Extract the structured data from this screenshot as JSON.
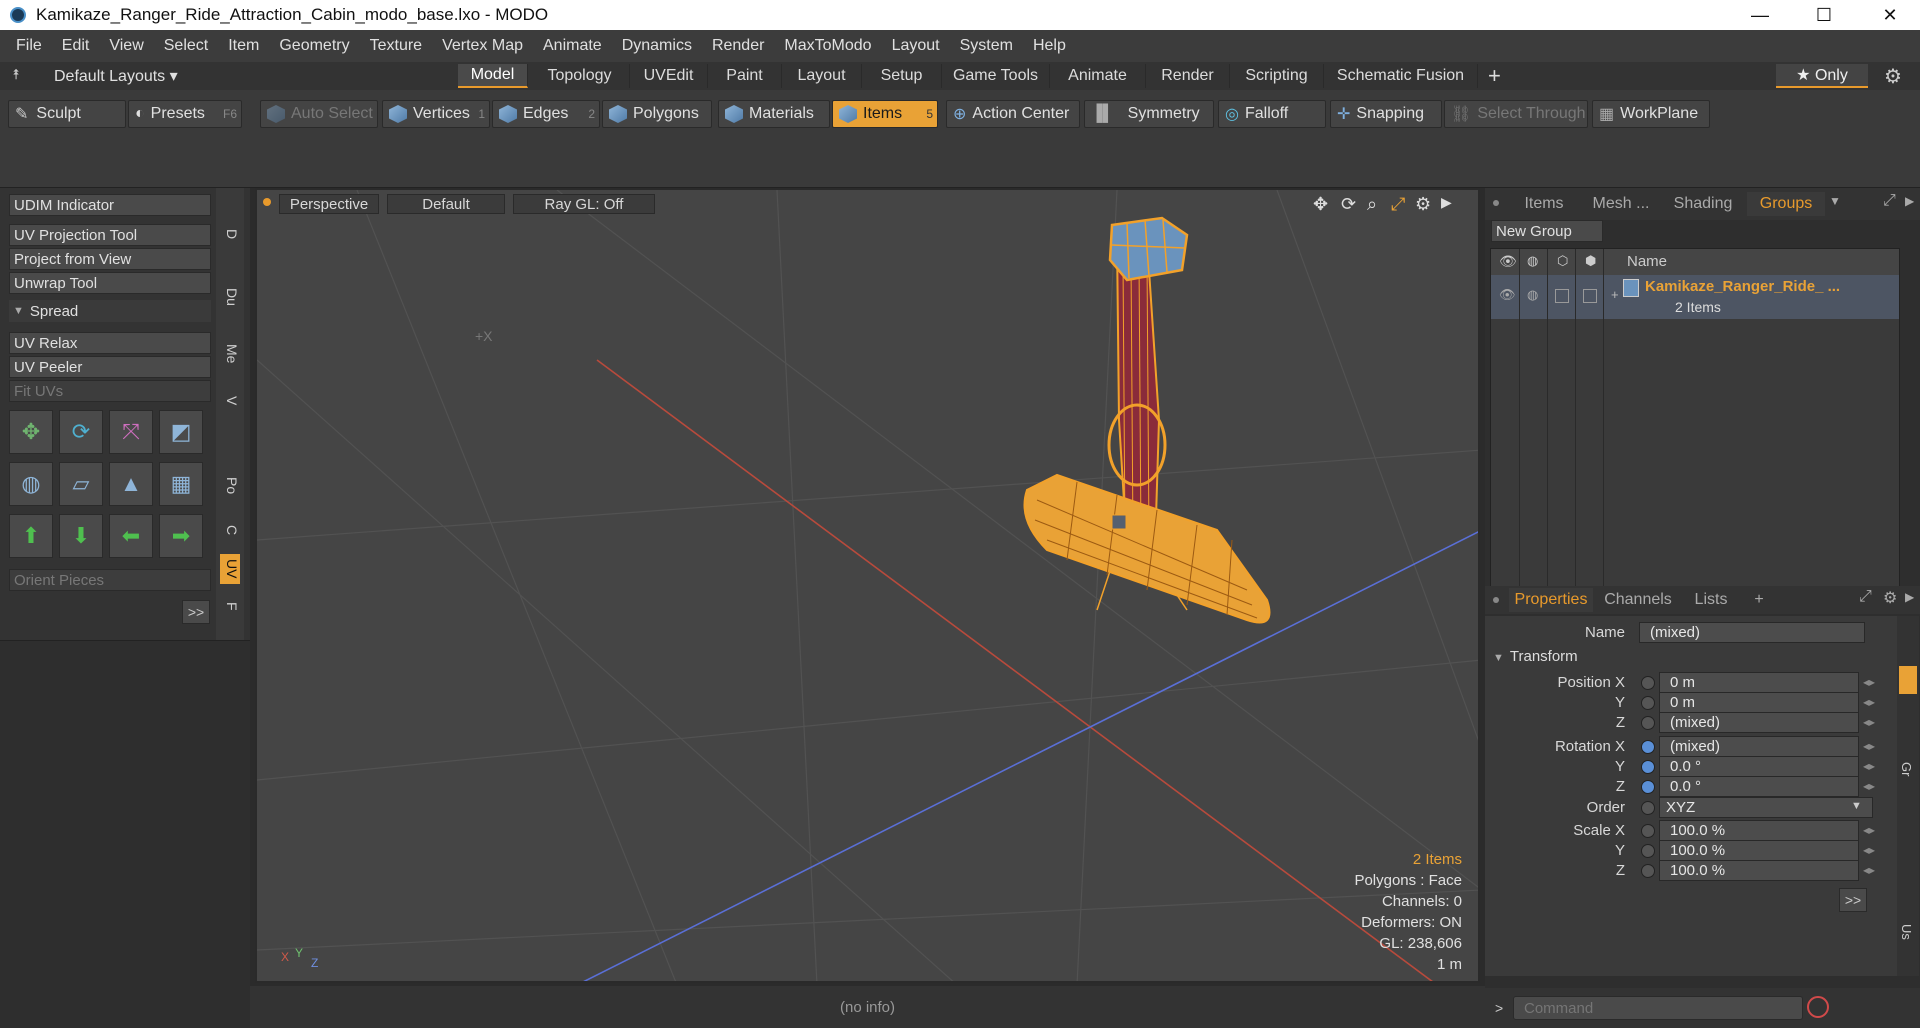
{
  "window": {
    "title": "Kamikaze_Ranger_Ride_Attraction_Cabin_modo_base.lxo - MODO",
    "minimize": "—",
    "maximize": "☐",
    "close": "✕"
  },
  "menu": [
    "File",
    "Edit",
    "View",
    "Select",
    "Item",
    "Geometry",
    "Texture",
    "Vertex Map",
    "Animate",
    "Dynamics",
    "Render",
    "MaxToModo",
    "Layout",
    "System",
    "Help"
  ],
  "layout": {
    "preset": "Default Layouts ▾",
    "tabs": [
      "Model",
      "Topology",
      "UVEdit",
      "Paint",
      "Layout",
      "Setup",
      "Game Tools",
      "Animate",
      "Render",
      "Scripting",
      "Schematic Fusion"
    ],
    "add": "+",
    "only": "★ Only"
  },
  "toolbar": {
    "sculpt": "Sculpt",
    "presets": "Presets",
    "presets_key": "F6",
    "auto_select": "Auto Select",
    "vertices": "Vertices",
    "vertices_num": "1",
    "edges": "Edges",
    "edges_num": "2",
    "polygons": "Polygons",
    "materials": "Materials",
    "items": "Items",
    "items_num": "5",
    "action_center": "Action Center",
    "symmetry": "Symmetry",
    "falloff": "Falloff",
    "snapping": "Snapping",
    "select_through": "Select Through",
    "workplane": "WorkPlane"
  },
  "left": {
    "udim": "UDIM Indicator",
    "uvproj": "UV Projection Tool",
    "projview": "Project from View",
    "unwrap": "Unwrap Tool",
    "spread": "Spread",
    "uvrelax": "UV Relax",
    "uvpeeler": "UV Peeler",
    "fituvs": "Fit UVs",
    "orient": "Orient Pieces",
    "more": ">>",
    "vtabs": [
      "D",
      "Du",
      "Me",
      "V",
      "Po",
      "C",
      "UV",
      "F"
    ]
  },
  "viewport": {
    "view": "Perspective",
    "shading": "Default",
    "raygl": "Ray GL: Off",
    "info": {
      "items": "2 Items",
      "polygons": "Polygons : Face",
      "channels": "Channels: 0",
      "deformers": "Deformers: ON",
      "gl": "GL: 238,606",
      "unit": "1 m"
    },
    "axis_x": "X",
    "axis_y": "Y",
    "axis_z": "Z",
    "marker": "+X"
  },
  "status": "(no info)",
  "groups": {
    "tabs": [
      "Items",
      "Mesh ...",
      "Shading",
      "Groups"
    ],
    "new_group": "New Group",
    "col_name": "Name",
    "row_name": "Kamikaze_Ranger_Ride_ ...",
    "row_count": "2 Items"
  },
  "props": {
    "tabs": [
      "Properties",
      "Channels",
      "Lists"
    ],
    "add": "+",
    "name_label": "Name",
    "name_value": "(mixed)",
    "transform": "Transform",
    "rows": [
      {
        "label": "Position X",
        "value": "0 m"
      },
      {
        "label": "Y",
        "value": "0 m"
      },
      {
        "label": "Z",
        "value": "(mixed)"
      },
      {
        "label": "Rotation X",
        "value": "(mixed)"
      },
      {
        "label": "Y",
        "value": "0.0 °"
      },
      {
        "label": "Z",
        "value": "0.0 °"
      },
      {
        "label": "Order",
        "value": "XYZ"
      },
      {
        "label": "Scale X",
        "value": "100.0 %"
      },
      {
        "label": "Y",
        "value": "100.0 %"
      },
      {
        "label": "Z",
        "value": "100.0 %"
      }
    ],
    "more": ">>",
    "side_tabs": [
      "Gr",
      "Us"
    ]
  },
  "command": {
    "prompt": ">",
    "placeholder": "Command"
  },
  "colors": {
    "accent": "#e9a236",
    "selected_wire": "#f2a12a",
    "pole": "#8a2b3a",
    "x_axis": "#b84a3c",
    "z_axis": "#5a6fd6"
  }
}
